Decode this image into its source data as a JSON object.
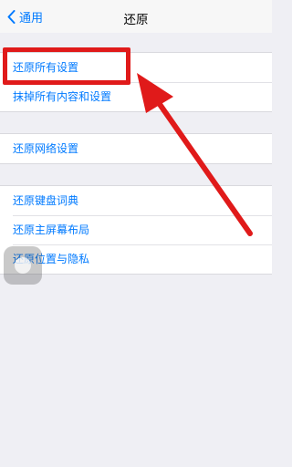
{
  "navbar": {
    "back_label": "通用",
    "title": "还原"
  },
  "groups": [
    {
      "items": [
        {
          "label": "还原所有设置"
        },
        {
          "label": "抹掉所有内容和设置"
        }
      ]
    },
    {
      "items": [
        {
          "label": "还原网络设置"
        }
      ]
    },
    {
      "items": [
        {
          "label": "还原键盘词典"
        },
        {
          "label": "还原主屏幕布局"
        },
        {
          "label": "还原位置与隐私"
        }
      ]
    }
  ],
  "colors": {
    "accent": "#007aff",
    "annotation_red": "#e01a1a",
    "background": "#efeff4"
  },
  "icons": {
    "back": "chevron-left-icon",
    "assistive_touch": "assistive-touch-icon"
  }
}
